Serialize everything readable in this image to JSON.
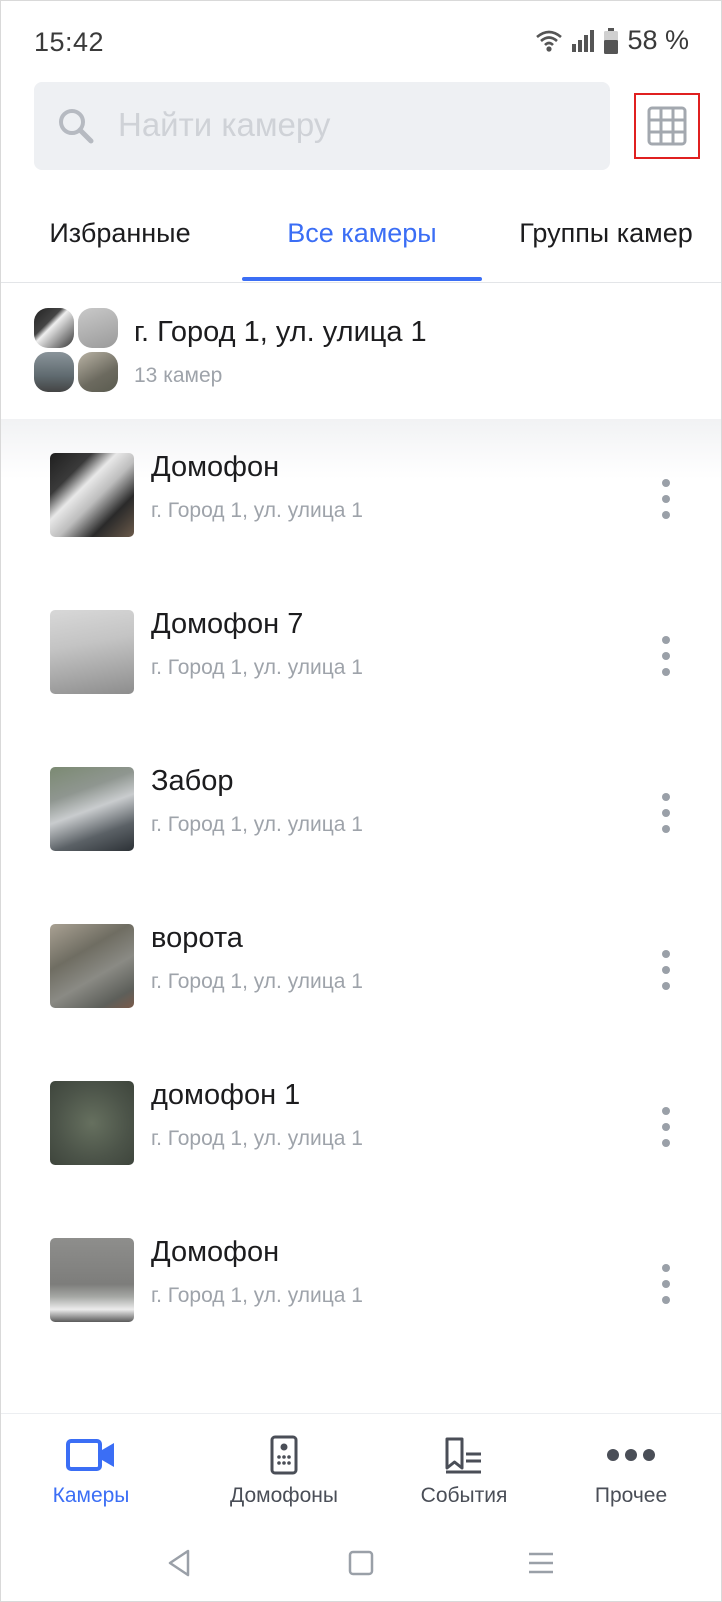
{
  "status_bar": {
    "time": "15:42",
    "battery": "58 %",
    "icons": [
      "wifi-icon",
      "signal-icon",
      "battery-icon"
    ]
  },
  "search": {
    "placeholder": "Найти камеру",
    "icon": "search-icon"
  },
  "grid_view_button": {
    "icon": "grid-icon",
    "highlight_color": "#e02020"
  },
  "tabs": [
    {
      "label": "Избранные",
      "active": false
    },
    {
      "label": "Все камеры",
      "active": true
    },
    {
      "label": "Группы камер",
      "active": false
    }
  ],
  "group": {
    "title": "г. Город  1,  ул. улица 1",
    "count": "13 камер"
  },
  "cameras": [
    {
      "name": "Домофон",
      "address": "г. Город 1, ул. улица 1"
    },
    {
      "name": "Домофон 7",
      "address": "г. Город 1, ул. улица 1"
    },
    {
      "name": "Забор",
      "address": "г. Город 1, ул. улица 1"
    },
    {
      "name": "ворота",
      "address": "г. Город 1, ул. улица 1"
    },
    {
      "name": "домофон 1",
      "address": "г. Город 1, ул. улица 1"
    },
    {
      "name": "Домофон",
      "address": "г. Город 1, ул. улица 1"
    }
  ],
  "bottom_nav": [
    {
      "label": "Камеры",
      "icon": "video-camera-icon",
      "active": true
    },
    {
      "label": "Домофоны",
      "icon": "intercom-icon",
      "active": false
    },
    {
      "label": "События",
      "icon": "events-icon",
      "active": false
    },
    {
      "label": "Прочее",
      "icon": "more-dots-icon",
      "active": false
    }
  ],
  "colors": {
    "accent": "#3b6ef5",
    "text_primary": "#1c1c1e",
    "text_secondary": "#9ea3aa",
    "search_bg": "#eef0f3"
  }
}
